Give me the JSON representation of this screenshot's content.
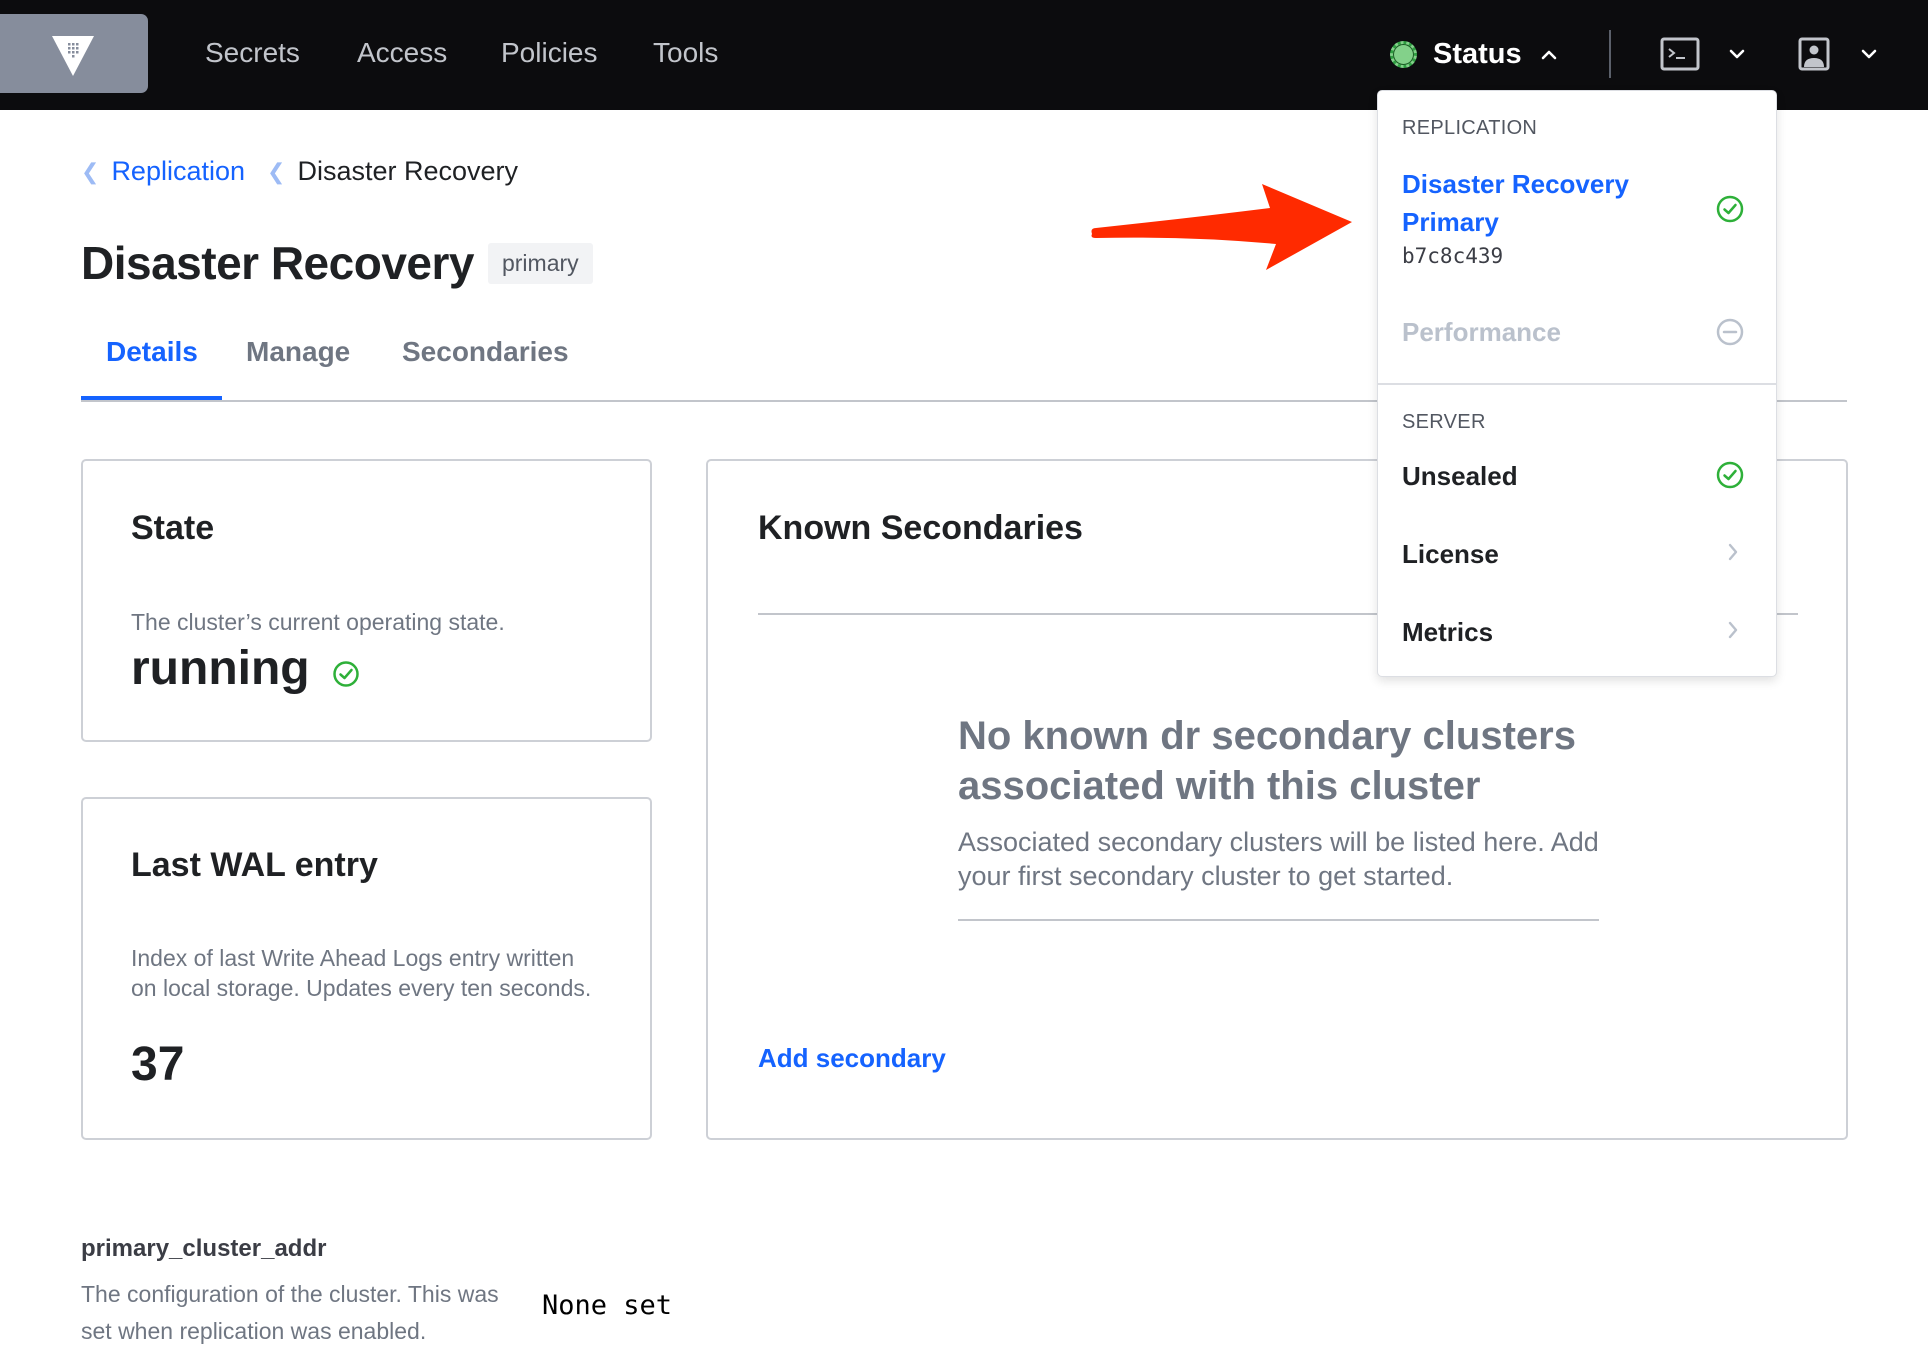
{
  "nav": {
    "logo": "vault-logo",
    "links": [
      "Secrets",
      "Access",
      "Policies",
      "Tools"
    ],
    "status_label": "Status",
    "status_color": "#83d18a"
  },
  "status_menu": {
    "replication_heading": "REPLICATION",
    "dr_line1": "Disaster Recovery",
    "dr_line2": "Primary",
    "dr_cluster_id": "b7c8c439",
    "performance_label": "Performance",
    "server_heading": "SERVER",
    "unsealed_label": "Unsealed",
    "license_label": "License",
    "metrics_label": "Metrics"
  },
  "breadcrumb": {
    "parent": "Replication",
    "current": "Disaster Recovery"
  },
  "page": {
    "title": "Disaster Recovery",
    "badge": "primary"
  },
  "tabs": [
    "Details",
    "Manage",
    "Secondaries"
  ],
  "state_card": {
    "title": "State",
    "description": "The cluster’s current operating state.",
    "value": "running"
  },
  "wal_card": {
    "title": "Last WAL entry",
    "description": "Index of last Write Ahead Logs entry written on local storage. Updates every ten seconds.",
    "value": "37"
  },
  "secondaries_card": {
    "title": "Known Secondaries",
    "empty_title": "No known dr secondary clusters associated with this cluster",
    "empty_body": "Associated secondary clusters will be listed here. Add your first secondary cluster to get started.",
    "add_link": "Add secondary"
  },
  "config": {
    "label": "primary_cluster_addr",
    "description": "The configuration of the cluster. This was set when replication was enabled.",
    "value": "None set"
  },
  "colors": {
    "accent": "#1563ff",
    "success": "#2eb039",
    "annotation": "#ff2a00",
    "nav_bg": "#0c0c0e"
  }
}
